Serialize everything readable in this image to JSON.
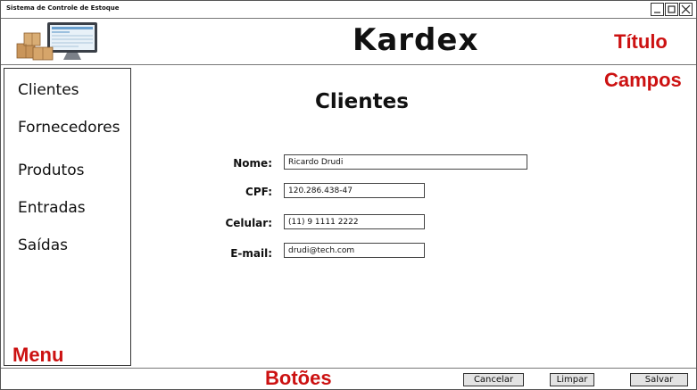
{
  "window": {
    "title": "Sistema de Controle de Estoque"
  },
  "header": {
    "app_title": "Kardex"
  },
  "annotations": {
    "titulo": "Título",
    "campos": "Campos",
    "menu": "Menu",
    "botoes": "Botões"
  },
  "sidebar": {
    "items": [
      {
        "label": "Clientes"
      },
      {
        "label": "Fornecedores"
      },
      {
        "label": "Produtos"
      },
      {
        "label": "Entradas"
      },
      {
        "label": "Saídas"
      }
    ]
  },
  "main": {
    "section_title": "Clientes",
    "fields": [
      {
        "label": "Nome:",
        "value": "Ricardo Drudi"
      },
      {
        "label": "CPF:",
        "value": "120.286.438-47"
      },
      {
        "label": "Celular:",
        "value": "(11) 9 1111 2222"
      },
      {
        "label": "E-mail:",
        "value": "drudi@tech.com"
      }
    ]
  },
  "footer": {
    "cancel_label": "Cancelar",
    "clear_label": "Limpar",
    "save_label": "Salvar"
  },
  "icons": {
    "minimize": "minimize-icon",
    "maximize": "maximize-icon",
    "close": "close-icon",
    "logo": "computer-boxes-logo"
  },
  "colors": {
    "annotation": "#cc1111",
    "button_bg": "#e3e3e3"
  }
}
